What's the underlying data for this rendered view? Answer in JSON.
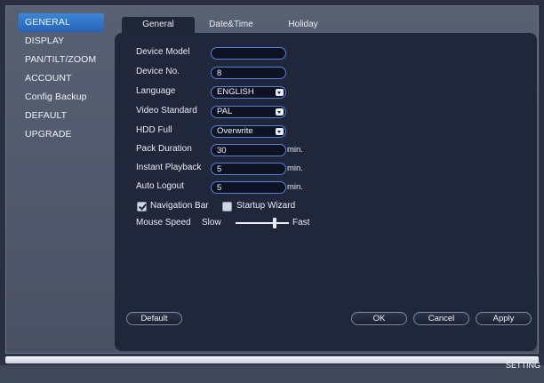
{
  "sidebar": {
    "items": [
      {
        "label": "GENERAL",
        "active": true
      },
      {
        "label": "DISPLAY"
      },
      {
        "label": "PAN/TILT/ZOOM"
      },
      {
        "label": "ACCOUNT"
      },
      {
        "label": "Config Backup"
      },
      {
        "label": "DEFAULT"
      },
      {
        "label": "UPGRADE"
      }
    ]
  },
  "tabs": [
    {
      "label": "General",
      "active": true
    },
    {
      "label": "Date&Time"
    },
    {
      "label": "Holiday"
    }
  ],
  "form": {
    "device_model": {
      "label": "Device Model",
      "value": ""
    },
    "device_no": {
      "label": "Device No.",
      "value": "8"
    },
    "language": {
      "label": "Language",
      "value": "ENGLISH"
    },
    "video_standard": {
      "label": "Video Standard",
      "value": "PAL"
    },
    "hdd_full": {
      "label": "HDD Full",
      "value": "Overwrite"
    },
    "pack_duration": {
      "label": "Pack Duration",
      "value": "30",
      "unit": "min."
    },
    "instant_playback": {
      "label": "Instant Playback",
      "value": "5",
      "unit": "min."
    },
    "auto_logout": {
      "label": "Auto Logout",
      "value": "5",
      "unit": "min."
    },
    "navigation_bar": {
      "label": "Navigation Bar",
      "checked": true
    },
    "startup_wizard": {
      "label": "Startup Wizard",
      "checked": false
    },
    "mouse_speed": {
      "label": "Mouse Speed",
      "slow_label": "Slow",
      "fast_label": "Fast",
      "level": 0.75
    }
  },
  "buttons": {
    "default": "Default",
    "ok": "OK",
    "cancel": "Cancel",
    "apply": "Apply"
  },
  "footer": {
    "label": "SETTING"
  },
  "colors": {
    "accent": "#2f74c9",
    "panel": "#20273a",
    "frame": "#525b6d"
  }
}
